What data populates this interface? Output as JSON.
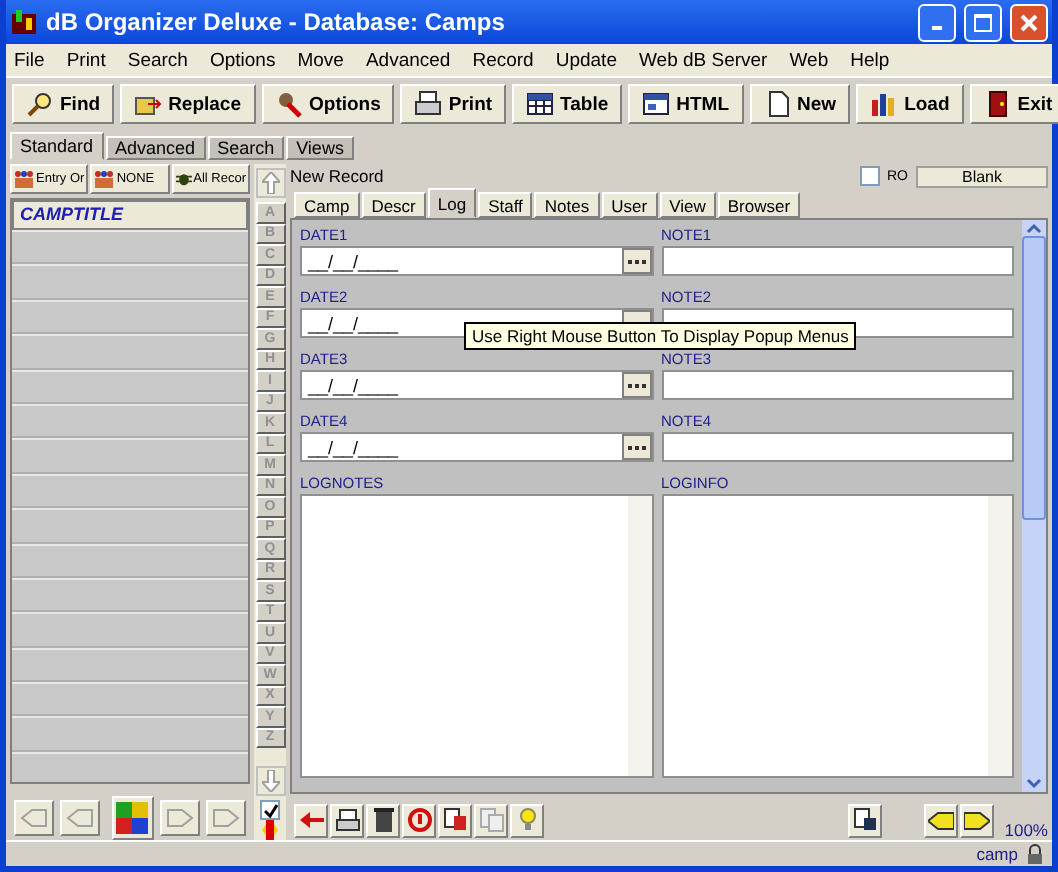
{
  "window": {
    "title": "dB Organizer Deluxe - Database: Camps"
  },
  "menu": [
    "File",
    "Print",
    "Search",
    "Options",
    "Move",
    "Advanced",
    "Record",
    "Update",
    "Web dB Server",
    "Web",
    "Help"
  ],
  "toolbar": [
    {
      "label": "Find",
      "kind": "find"
    },
    {
      "label": "Replace",
      "kind": "replace"
    },
    {
      "label": "Options",
      "kind": "options"
    },
    {
      "label": "Print",
      "kind": "print"
    },
    {
      "label": "Table",
      "kind": "table"
    },
    {
      "label": "HTML",
      "kind": "html"
    },
    {
      "label": "New",
      "kind": "new"
    },
    {
      "label": "Load",
      "kind": "load"
    },
    {
      "label": "Exit",
      "kind": "exit"
    }
  ],
  "view_tabs": [
    {
      "label": "Standard",
      "selected": true
    },
    {
      "label": "Advanced",
      "selected": false
    },
    {
      "label": "Search",
      "selected": false
    },
    {
      "label": "Views",
      "selected": false
    }
  ],
  "filter_buttons": [
    {
      "label": "Entry Or",
      "kind": "people"
    },
    {
      "label": "NONE",
      "kind": "people"
    },
    {
      "label": "All Recor",
      "kind": "all"
    }
  ],
  "list": {
    "column": "CAMPTITLE"
  },
  "letters": [
    "A",
    "B",
    "C",
    "D",
    "E",
    "F",
    "G",
    "H",
    "I",
    "J",
    "K",
    "L",
    "M",
    "N",
    "O",
    "P",
    "Q",
    "R",
    "S",
    "T",
    "U",
    "V",
    "W",
    "X",
    "Y",
    "Z"
  ],
  "record": {
    "label": "New Record",
    "ro_label": "RO",
    "ro_checked": false,
    "blank_button": "Blank"
  },
  "record_tabs": [
    {
      "label": "Camp",
      "selected": false
    },
    {
      "label": "Descr",
      "selected": false
    },
    {
      "label": "Log",
      "selected": true
    },
    {
      "label": "Staff",
      "selected": false
    },
    {
      "label": "Notes",
      "selected": false
    },
    {
      "label": "User",
      "selected": false
    },
    {
      "label": "View",
      "selected": false
    },
    {
      "label": "Browser",
      "selected": false
    }
  ],
  "fields": [
    {
      "label": "DATE1",
      "kind": "date",
      "value": "__/__/____"
    },
    {
      "label": "NOTE1",
      "kind": "text"
    },
    {
      "label": "DATE2",
      "kind": "date",
      "value": "__/__/____"
    },
    {
      "label": "NOTE2",
      "kind": "text"
    },
    {
      "label": "DATE3",
      "kind": "date",
      "value": "__/__/____"
    },
    {
      "label": "NOTE3",
      "kind": "text"
    },
    {
      "label": "DATE4",
      "kind": "date",
      "value": "__/__/____"
    },
    {
      "label": "NOTE4",
      "kind": "text"
    }
  ],
  "memos": [
    {
      "label": "LOGNOTES"
    },
    {
      "label": "LOGINFO"
    }
  ],
  "tooltip": "Use Right Mouse Button To Display Popup Menus",
  "bottom": {
    "sort_checked": true,
    "zoom": "100%"
  },
  "status_bar": {
    "user": "camp"
  }
}
